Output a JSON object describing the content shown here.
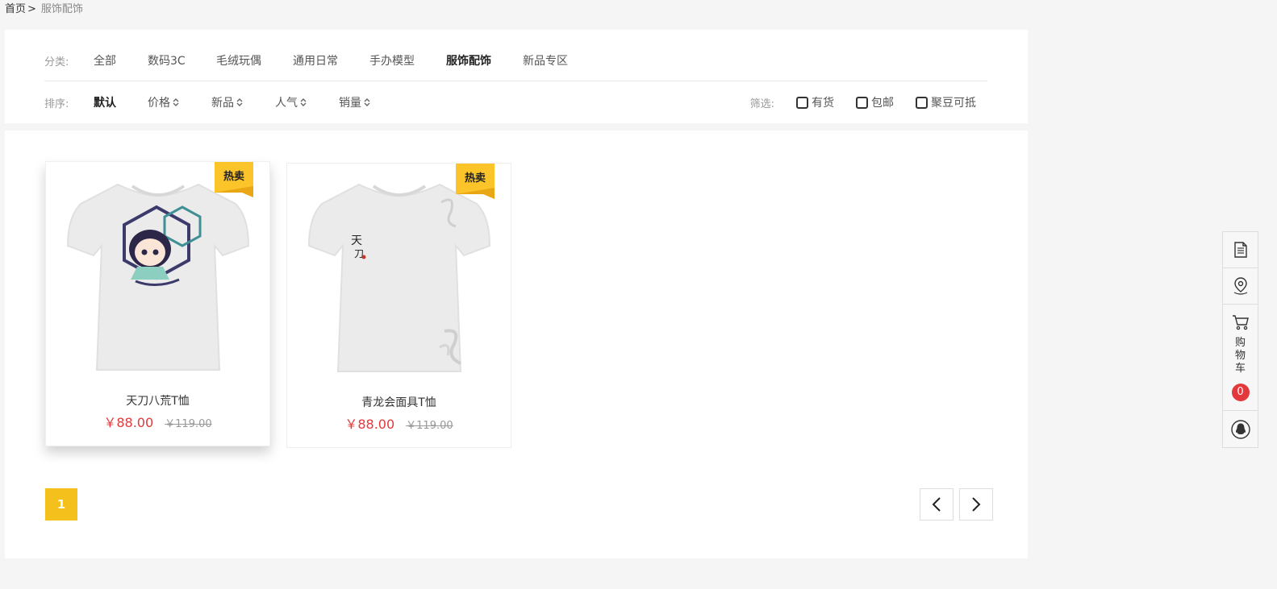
{
  "breadcrumb": {
    "home": "首页",
    "separator": ">",
    "current": "服饰配饰"
  },
  "category": {
    "label": "分类:",
    "items": [
      "全部",
      "数码3C",
      "毛绒玩偶",
      "通用日常",
      "手办模型",
      "服饰配饰",
      "新品专区"
    ],
    "active_index": 5
  },
  "sort": {
    "label": "排序:",
    "items": [
      "默认",
      "价格",
      "新品",
      "人气",
      "销量"
    ],
    "active_index": 0
  },
  "filter": {
    "label": "筛选:",
    "options": [
      "有货",
      "包邮",
      "聚豆可抵"
    ]
  },
  "products": [
    {
      "name": "天刀八荒T恤",
      "price": "￥88.00",
      "original_price": "￥119.00",
      "badge": "热卖"
    },
    {
      "name": "青龙会面具T恤",
      "price": "￥88.00",
      "original_price": "￥119.00",
      "badge": "热卖"
    }
  ],
  "pagination": {
    "current_page": "1"
  },
  "sidebar": {
    "cart_label": "购物车",
    "cart_count": "0"
  },
  "colors": {
    "accent": "#f4c01c",
    "badge": "#fbc52a",
    "price": "#e4393c"
  },
  "icons": [
    "document-icon",
    "location-icon",
    "cart-icon",
    "qq-icon",
    "chevron-left-icon",
    "chevron-right-icon"
  ]
}
